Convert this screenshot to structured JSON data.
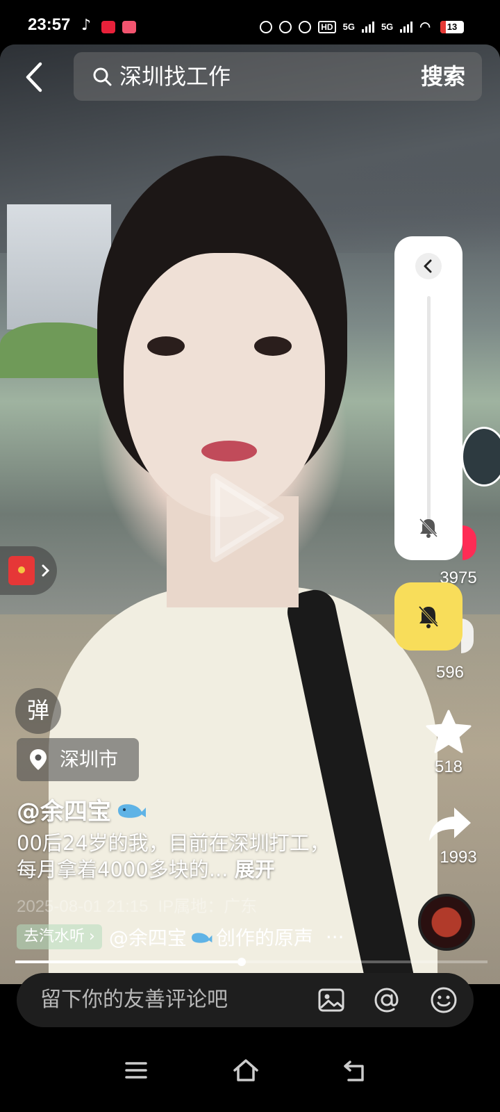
{
  "status_bar": {
    "time": "23:57",
    "battery": "13",
    "network_1": "5G",
    "network_2": "5G",
    "hd_label": "HD"
  },
  "search": {
    "query": "深圳找工作",
    "button": "搜索"
  },
  "actions": {
    "like_count": "3975",
    "comment_count": "596",
    "favorite_count": "518",
    "share_count": "1993"
  },
  "danmaku": {
    "label": "弹"
  },
  "location": {
    "name": "深圳市"
  },
  "post": {
    "author": "@余四宝",
    "caption_line1": "00后24岁的我，目前在深圳打工，",
    "caption_line2": "每月拿着4000多块的...",
    "expand_label": "展开",
    "date": "2025-08-01 21:15",
    "ip": "IP属地：广东"
  },
  "music": {
    "tag": "去汽水听",
    "title_prefix": "@余四宝",
    "title_suffix": "创作的原声",
    "more": "···"
  },
  "progress": {
    "played_fraction": 0.48
  },
  "comment": {
    "placeholder": "留下你的友善评论吧"
  },
  "colors": {
    "accent_yellow": "#f8dd5a",
    "like_red": "#fe2c55",
    "red_packet": "#e63737"
  },
  "icons": [
    "back-arrow",
    "search",
    "volume-collapse-chevron",
    "bell-off",
    "star",
    "share-arrow",
    "location-pin",
    "image",
    "at-sign",
    "emoji",
    "menu",
    "home",
    "back"
  ]
}
